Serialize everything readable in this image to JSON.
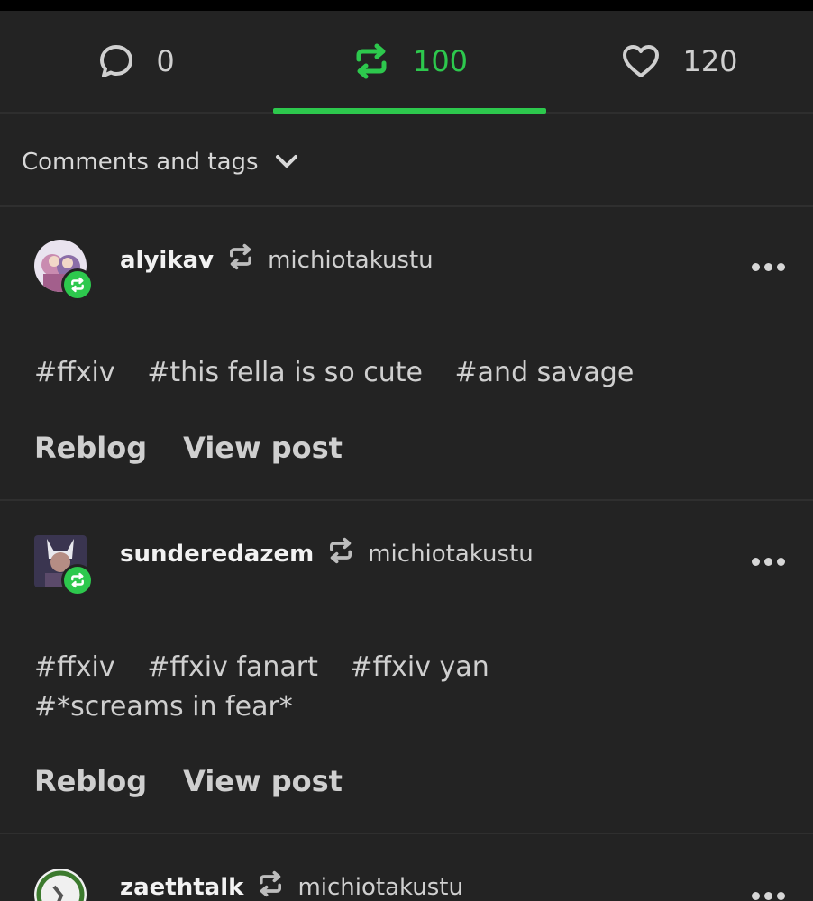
{
  "tabs": {
    "comments": {
      "count": "0",
      "icon": "comment-icon"
    },
    "reblogs": {
      "count": "100",
      "icon": "reblog-icon"
    },
    "likes": {
      "count": "120",
      "icon": "heart-icon"
    }
  },
  "filter": {
    "label": "Comments and tags",
    "icon": "chevron-down-icon"
  },
  "accent_color": "#2dc84d",
  "posts": [
    {
      "user": "alyikav",
      "source": "michiotakustu",
      "tags": [
        "#ffxiv",
        "#this fella is so cute",
        "#and savage"
      ],
      "reblog_label": "Reblog",
      "view_label": "View post"
    },
    {
      "user": "sunderedazem",
      "source": "michiotakustu",
      "tags": [
        "#ffxiv",
        "#ffxiv fanart",
        "#ffxiv yan",
        "#*screams in fear*"
      ],
      "reblog_label": "Reblog",
      "view_label": "View post"
    },
    {
      "user": "zaethtalk",
      "source": "michiotakustu"
    }
  ]
}
